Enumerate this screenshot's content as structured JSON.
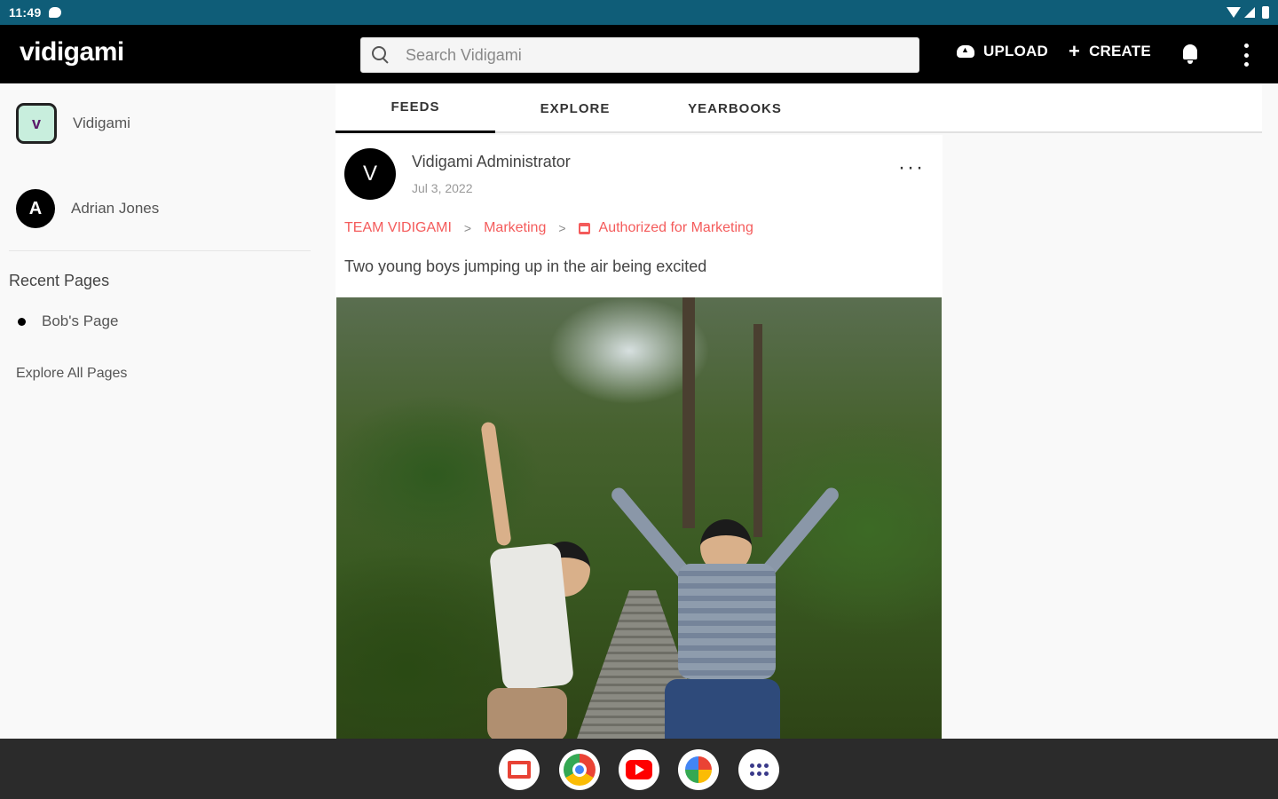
{
  "status_bar": {
    "time": "11:49"
  },
  "app": {
    "logo": "vidigami",
    "search_placeholder": "Search Vidigami",
    "upload_label": "UPLOAD",
    "create_label": "CREATE"
  },
  "sidebar": {
    "accounts": [
      {
        "name": "Vidigami",
        "initial": "V"
      },
      {
        "name": "Adrian Jones",
        "initial": "A"
      }
    ],
    "recent_title": "Recent Pages",
    "recent_pages": [
      "Bob's Page"
    ],
    "explore_all": "Explore All Pages"
  },
  "tabs": [
    {
      "label": "FEEDS",
      "active": true
    },
    {
      "label": "EXPLORE",
      "active": false
    },
    {
      "label": "YEARBOOKS",
      "active": false
    }
  ],
  "post": {
    "avatar_initial": "V",
    "author": "Vidigami Administrator",
    "date": "Jul 3, 2022",
    "more": "···",
    "breadcrumbs": [
      "TEAM VIDIGAMI",
      "Marketing",
      "Authorized for Marketing"
    ],
    "caption": "Two young boys jumping up in the air being excited"
  },
  "dock": [
    "gmail-icon",
    "chrome-icon",
    "youtube-icon",
    "photos-icon",
    "app-drawer-icon"
  ],
  "colors": {
    "status_bar": "#0f5d78",
    "app_bar": "#000000",
    "accent_link": "#f45b5b",
    "dock": "#2b2b2b"
  }
}
